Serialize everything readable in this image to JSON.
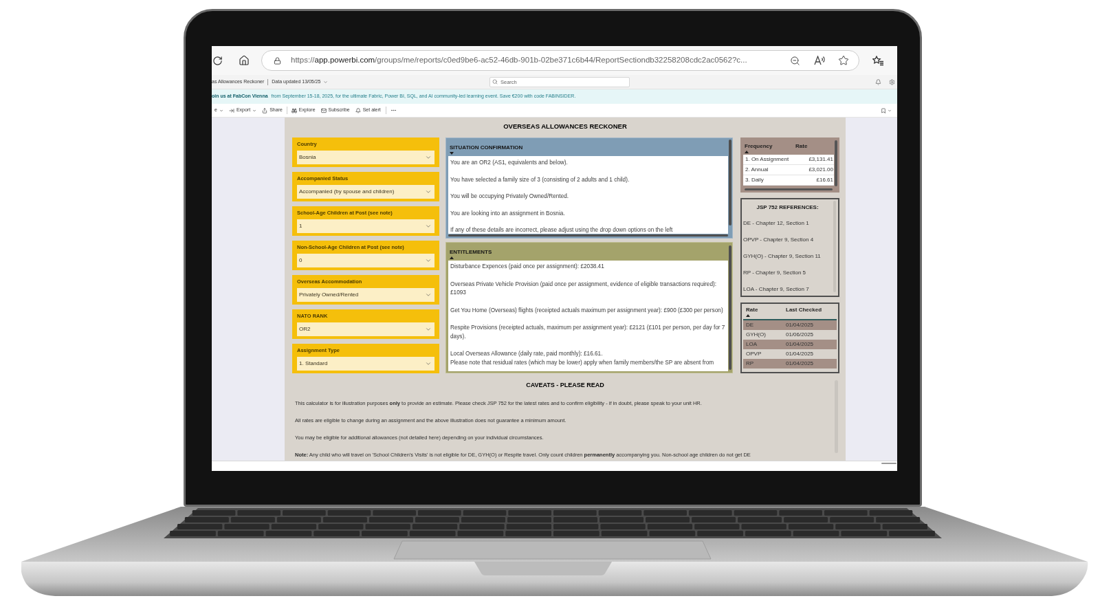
{
  "browser": {
    "url": {
      "scheme": "https://",
      "host": "app.powerbi.com",
      "path": "/groups/me/reports/c0ed9be6-ac52-46db-901b-02be371c6b44/ReportSectiondb32258208cdc2ac0562?c..."
    }
  },
  "app_header": {
    "report_name": "as Allowances Reckoner",
    "data_updated": "Data updated 13/05/25",
    "search": {
      "placeholder": "Search"
    }
  },
  "banner": {
    "link": "oin us at FabCon Vienna",
    "text": "from September 15-18, 2025, for the ultimate Fabric, Power BI, SQL, and AI community-led learning event. Save €200 with code FABINSIDER."
  },
  "toolbar": {
    "groups": [
      {
        "items": [
          {
            "kind": "menu",
            "label": "e"
          },
          {
            "kind": "export",
            "label": "Export"
          },
          {
            "kind": "share",
            "label": "Share"
          }
        ]
      },
      {
        "items": [
          {
            "kind": "explore",
            "label": "Explore"
          },
          {
            "kind": "subscribe",
            "label": "Subscribe"
          },
          {
            "kind": "alert",
            "label": "Set alert"
          }
        ]
      }
    ]
  },
  "report": {
    "title": "OVERSEAS ALLOWANCES RECKONER",
    "slicers": [
      {
        "label": "Country",
        "value": "Bosnia"
      },
      {
        "label": "Accompanied Status",
        "value": "Accompanied (by spouse and children)"
      },
      {
        "label": "School-Age Children at Post (see note)",
        "value": "1"
      },
      {
        "label": "Non-School-Age Children at Post (see note)",
        "value": "0"
      },
      {
        "label": "Overseas Accommodation",
        "value": "Privately Owned/Rented"
      },
      {
        "label": "NATO RANK",
        "value": "OR2"
      },
      {
        "label": "Assignment Type",
        "value": "1. Standard"
      }
    ],
    "situation": {
      "title": "SITUATION CONFIRMATION",
      "sorted": true,
      "descending": true,
      "lines": [
        "You are an OR2 (AS1, equivalents and below).",
        "You have selected a family size of 3 (consisting of 2 adults and 1 child).",
        "You will be occupying Privately Owned/Rented.",
        "You are looking into an assignment in Bosnia.",
        "If any of these details are incorrect, please adjust using the drop down options on the left"
      ]
    },
    "entitlements": {
      "title": "ENTITLEMENTS",
      "sorted": true,
      "descending": false,
      "paragraphs": [
        {
          "lines": [
            "Disturbance Expences (paid once per assignment): £2038.41"
          ]
        },
        {
          "lines": [
            "Overseas Private Vehicle Provision (paid once per assignment, evidence of eligible transactions required): £1093"
          ]
        },
        {
          "lines": [
            "Get You Home (Overseas) flights (receipted actuals maximum per assignment year): £900 (£300 per person)"
          ]
        },
        {
          "lines": [
            "Respite Provisions (receipted actuals, maximum per assignment year): £2121 (£101 per person, per day for 7 days)."
          ]
        },
        {
          "lines": [
            "Local Overseas Allowance (daily rate, paid monthly): £16.61.",
            "Please note that residual rates (which may be lower) apply when family members/the SP are absent from"
          ]
        }
      ]
    },
    "rates_table": {
      "columns": [
        {
          "label": "Frequency",
          "sorted": true,
          "descending": false
        },
        {
          "label": "Rate",
          "sorted": false
        }
      ],
      "rows": [
        {
          "cells": [
            "1. On Assignment",
            "£3,131.41"
          ]
        },
        {
          "cells": [
            "2. Annual",
            "£3,021.00"
          ]
        },
        {
          "cells": [
            "3. Daily",
            "£16.61"
          ]
        }
      ]
    },
    "references": {
      "title": "JSP 752 REFERENCES:",
      "lines": [
        "DE - Chapter 12, Section 1",
        "OPVP - Chapter 9, Section 4",
        "GYH(O) - Chapter 9, Section 11",
        "RP - Chapter 9, Section 5",
        "LOA - Chapter 9, Section 7"
      ]
    },
    "checked_table": {
      "columns": [
        {
          "label": "Rate",
          "sorted": true,
          "descending": false
        },
        {
          "label": "Last Checked",
          "sorted": false
        }
      ],
      "rows": [
        {
          "cells": [
            "DE",
            "01/04/2025"
          ]
        },
        {
          "cells": [
            "GYH(O)",
            "01/06/2025"
          ]
        },
        {
          "cells": [
            "LOA",
            "01/04/2025"
          ]
        },
        {
          "cells": [
            "OPVP",
            "01/04/2025"
          ]
        },
        {
          "cells": [
            "RP",
            "01/04/2025"
          ]
        }
      ]
    },
    "caveats": {
      "title": "CAVEATS - PLEASE READ",
      "paragraphs": [
        "This calculator is for illustration purposes **only** to provide an estimate. Please check JSP 752 for the latest rates and to confirm eligibility - if in doubt, please speak to your unit HR.",
        "All rates are eligible to change during an assignment and the above illustration does not guarantee a minimum amount.",
        "You may be eligible for additional allowances (not detailed here) depending on your individual circumstances.",
        "**Note:** Any child who will travel on 'School Children's Visits' is not eligible for DE, GYH(O) or Respite travel. Only count children **permanently** accompanying you. Non-school age children do not get DE"
      ]
    }
  }
}
